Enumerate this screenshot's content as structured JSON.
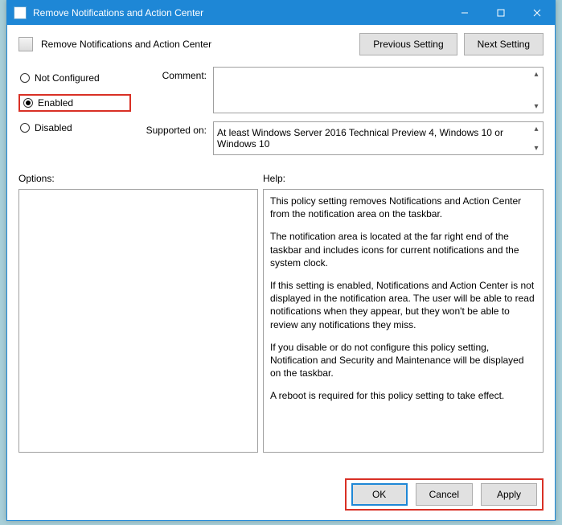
{
  "window": {
    "title": "Remove Notifications and Action Center"
  },
  "header": {
    "title": "Remove Notifications and Action Center",
    "previous_label": "Previous Setting",
    "next_label": "Next Setting"
  },
  "radios": {
    "not_configured": "Not Configured",
    "enabled": "Enabled",
    "disabled": "Disabled",
    "selected": "enabled"
  },
  "fields": {
    "comment_label": "Comment:",
    "comment_value": "",
    "supported_label": "Supported on:",
    "supported_value": "At least Windows Server 2016 Technical Preview 4, Windows 10 or Windows 10"
  },
  "sections": {
    "options_label": "Options:",
    "help_label": "Help:"
  },
  "help_text": {
    "p1": "This policy setting removes Notifications and Action Center from the notification area on the taskbar.",
    "p2": "The notification area is located at the far right end of the taskbar and includes icons for current notifications and the system clock.",
    "p3": "If this setting is enabled, Notifications and Action Center is not displayed in the notification area. The user will be able to read notifications when they appear, but they won't be able to review any notifications they miss.",
    "p4": "If you disable or do not configure this policy setting, Notification and Security and Maintenance will be displayed on the taskbar.",
    "p5": "A reboot is required for this policy setting to take effect."
  },
  "buttons": {
    "ok": "OK",
    "cancel": "Cancel",
    "apply": "Apply"
  }
}
